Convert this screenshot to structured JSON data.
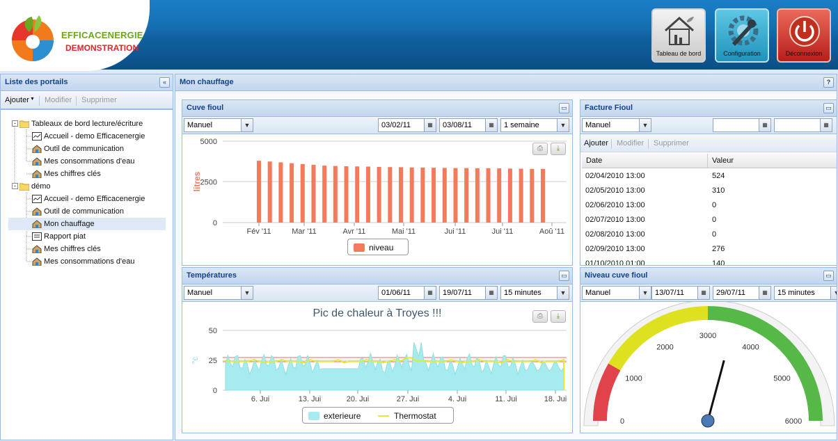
{
  "brand": {
    "line1": "EFFICACENERGIE",
    "line2": "DEMONSTRATION"
  },
  "header_buttons": [
    {
      "label": "Tableau  de  bord",
      "icon": "house-icon"
    },
    {
      "label": "Configuration",
      "icon": "wrench-gear-icon"
    },
    {
      "label": "Déconnexion",
      "icon": "power-icon"
    }
  ],
  "left_panel": {
    "title": "Liste des portails",
    "toolbar": {
      "add": "Ajouter",
      "edit": "Modifier",
      "delete": "Supprimer"
    },
    "tree": [
      {
        "label": "Tableaux de bord lecture/écriture",
        "type": "folder",
        "level": 0
      },
      {
        "label": "Accueil - demo Efficacenergie",
        "type": "dashboard",
        "level": 1
      },
      {
        "label": "Outil de communication",
        "type": "page",
        "level": 1
      },
      {
        "label": "Mes consommations d'eau",
        "type": "page",
        "level": 1
      },
      {
        "label": "Mes chiffres clés",
        "type": "page",
        "level": 1
      },
      {
        "label": "démo",
        "type": "folder",
        "level": 0
      },
      {
        "label": "Accueil - demo Efficacenergie",
        "type": "dashboard",
        "level": 1
      },
      {
        "label": "Outil de communication",
        "type": "page",
        "level": 1
      },
      {
        "label": "Mon chauffage",
        "type": "page",
        "level": 1,
        "selected": true
      },
      {
        "label": "Rapport piat",
        "type": "report",
        "level": 1
      },
      {
        "label": "Mes chiffres clés",
        "type": "page",
        "level": 1
      },
      {
        "label": "Mes consommations d'eau",
        "type": "page",
        "level": 1
      }
    ]
  },
  "main": {
    "title": "Mon chauffage",
    "help": "?"
  },
  "cuve": {
    "title": "Cuve fioul",
    "mode": "Manuel",
    "from": "03/02/11",
    "to": "03/08/11",
    "period": "1 semaine"
  },
  "facture": {
    "title": "Facture Fioul",
    "mode": "Manuel",
    "from": "",
    "to": "",
    "toolbar": {
      "add": "Ajouter",
      "edit": "Modifier",
      "delete": "Supprimer"
    },
    "columns": [
      "Date",
      "Valeur"
    ],
    "rows": [
      [
        "02/04/2010 13:00",
        "524"
      ],
      [
        "02/05/2010 13:00",
        "310"
      ],
      [
        "02/06/2010 13:00",
        "0"
      ],
      [
        "02/07/2010 13:00",
        "0"
      ],
      [
        "02/08/2010 13:00",
        "0"
      ],
      [
        "02/09/2010 13:00",
        "276"
      ],
      [
        "01/10/2010 01:00",
        "140"
      ]
    ]
  },
  "temps": {
    "title": "Températures",
    "mode": "Manuel",
    "from": "01/06/11",
    "to": "19/07/11",
    "period": "15 minutes"
  },
  "niveau": {
    "title": "Niveau cuve fioul",
    "mode": "Manuel",
    "from": "13/07/11",
    "to": "29/07/11",
    "period": "15 minutes"
  },
  "chart_data": [
    {
      "type": "bar",
      "ylabel": "litres",
      "ylim": [
        0,
        5000
      ],
      "yticks": [
        "5000",
        "2500",
        "0"
      ],
      "xticks": [
        "Fév '11",
        "Mar '11",
        "Avr '11",
        "Mai '11",
        "Jui '11",
        "Jui '11",
        "Aoû '11"
      ],
      "series": [
        {
          "name": "niveau",
          "color": "#f47a5c",
          "values": [
            3800,
            3750,
            3700,
            3650,
            3600,
            3550,
            3500,
            3480,
            3460,
            3450,
            3440,
            3420,
            3410,
            3400,
            3390,
            3380,
            3370,
            3360,
            3350,
            3350,
            3340,
            3340,
            3330,
            3320,
            3310,
            3300,
            3300
          ]
        }
      ],
      "legend": "bottom"
    },
    {
      "type": "area",
      "title": "Pic de chaleur à Troyes !!!",
      "ylabel": "°c",
      "ylim": [
        0,
        50
      ],
      "yticks": [
        "50",
        "25",
        "0"
      ],
      "xticks": [
        "6. Jui",
        "13. Jui",
        "20. Jui",
        "27. Jui",
        "4. Jui",
        "11. Jui",
        "18. Jui"
      ],
      "series": [
        {
          "name": "exterieure",
          "color": "#a6ecef",
          "type": "area"
        },
        {
          "name": "Thermostat",
          "color": "#e7e832",
          "type": "line",
          "value": 24
        }
      ],
      "legend": "bottom"
    },
    {
      "type": "gauge",
      "min": 0,
      "max": 6000,
      "value": 3500,
      "ticks": [
        "0",
        "1000",
        "2000",
        "3000",
        "4000",
        "5000",
        "6000"
      ],
      "bands": [
        {
          "from": 0,
          "to": 1000,
          "color": "#e0434a"
        },
        {
          "from": 1000,
          "to": 3000,
          "color": "#dde120"
        },
        {
          "from": 3000,
          "to": 6000,
          "color": "#56b947"
        }
      ]
    }
  ]
}
